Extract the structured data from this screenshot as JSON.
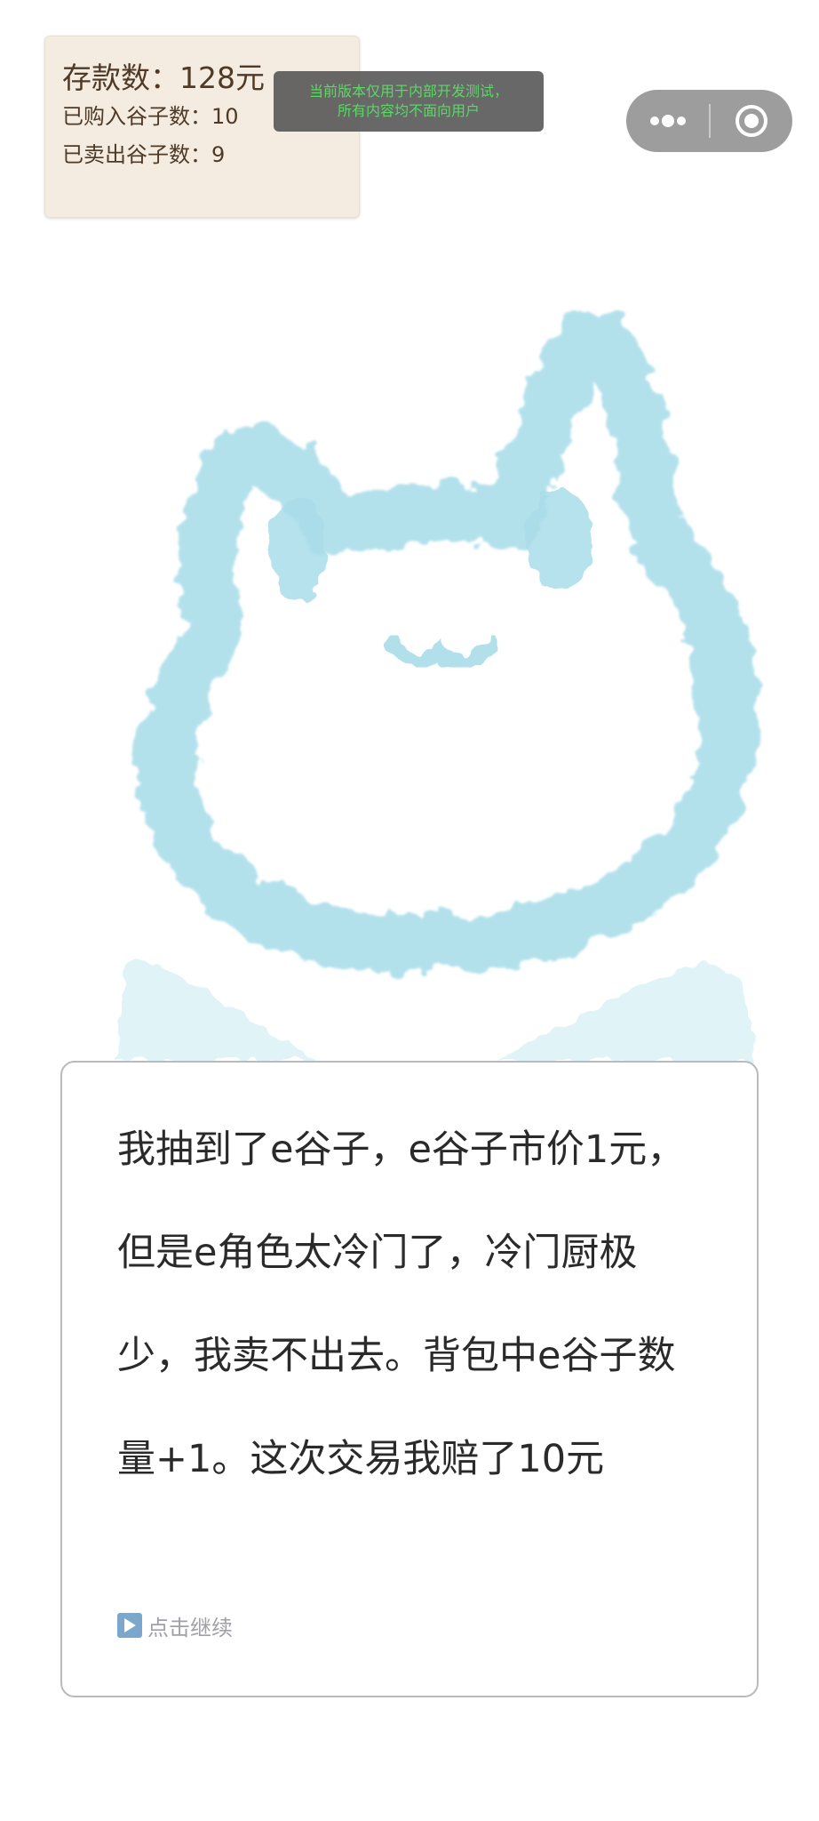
{
  "stats": {
    "savings": "存款数：128元",
    "bought": "已购入谷子数：10",
    "sold": "已卖出谷子数：9"
  },
  "dev_notice": {
    "line1": "当前版本仅用于内部开发测试，",
    "line2": "所有内容均不面向用户"
  },
  "capsule": {
    "more_icon": "more-dots-icon",
    "close_icon": "target-circle-icon"
  },
  "illustration": {
    "subject": "cat-face-watercolor",
    "color": "#a9dde9"
  },
  "dialog": {
    "text": "我抽到了e谷子，e谷子市价1元，但是e角色太冷门了，冷门厨极少，我卖不出去。背包中e谷子数量+1。这次交易我赔了10元",
    "continue_label": "点击继续",
    "continue_icon": "play-icon"
  },
  "colors": {
    "stats_bg": "#f4ece0",
    "stats_text": "#4e3a26",
    "notice_text": "#59d964",
    "cat": "#a9dde9",
    "dialog_border": "#b9b9c2",
    "hint": "#a0a0a8"
  }
}
